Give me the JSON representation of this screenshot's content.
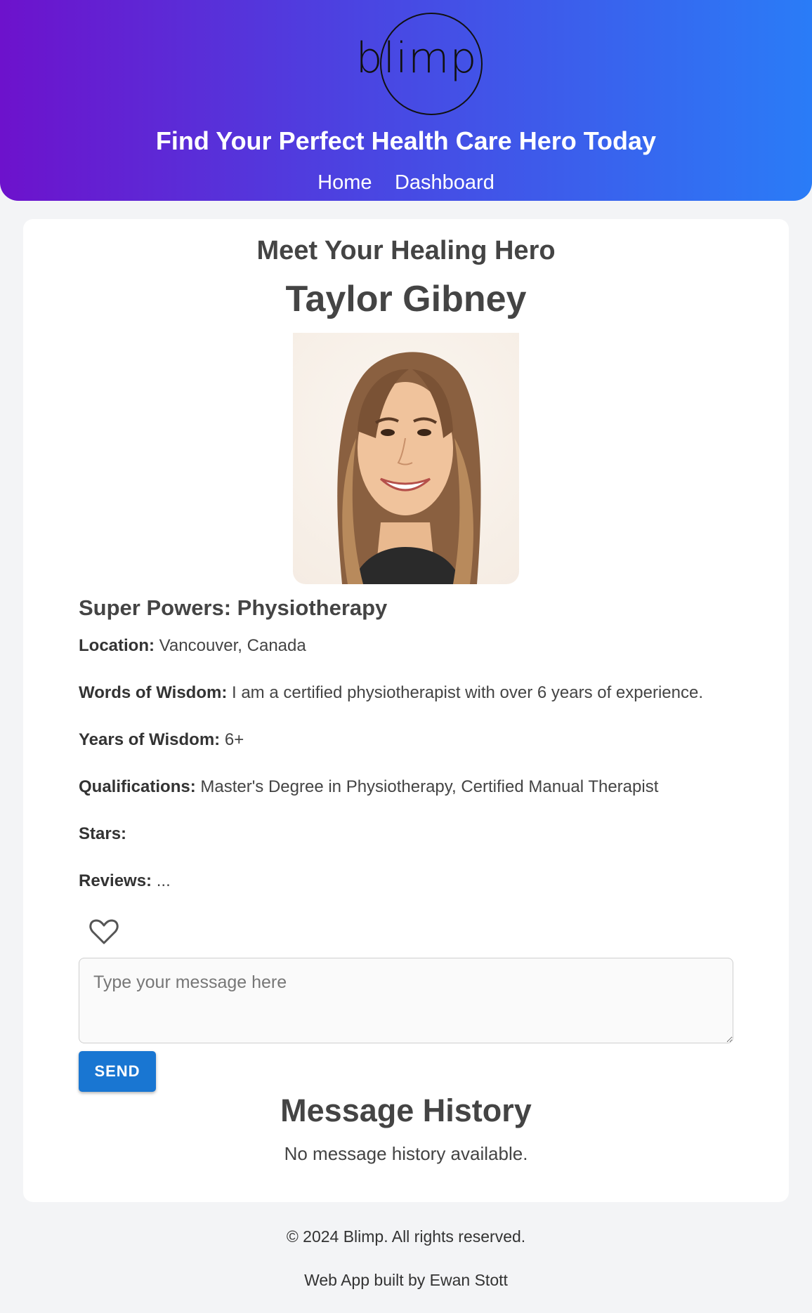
{
  "header": {
    "logo_text": "blimp",
    "tagline": "Find Your Perfect Health Care Hero Today",
    "nav": [
      {
        "label": "Home"
      },
      {
        "label": "Dashboard"
      }
    ],
    "colors": {
      "gradient_start": "#6d12cc",
      "gradient_end": "#2a7cf7"
    }
  },
  "profile": {
    "intro": "Meet Your Healing Hero",
    "name": "Taylor Gibney",
    "super_powers": "Super Powers: Physiotherapy",
    "fields": [
      {
        "label": "Location:",
        "value": "Vancouver, Canada"
      },
      {
        "label": "Words of Wisdom:",
        "value": "I am a certified physiotherapist with over 6 years of experience."
      },
      {
        "label": "Years of Wisdom:",
        "value": "6+"
      },
      {
        "label": "Qualifications:",
        "value": "Master's Degree in Physiotherapy, Certified Manual Therapist"
      },
      {
        "label": "Stars:",
        "value": ""
      },
      {
        "label": "Reviews:",
        "value": "..."
      }
    ],
    "favorite_icon": "heart-outline-icon"
  },
  "messaging": {
    "placeholder": "Type your message here",
    "send_label": "SEND",
    "accent": "#1976d2",
    "history_title": "Message History",
    "history_empty": "No message history available."
  },
  "footer": {
    "copyright": "© 2024 Blimp. All rights reserved.",
    "credit": "Web App built by Ewan Stott"
  }
}
